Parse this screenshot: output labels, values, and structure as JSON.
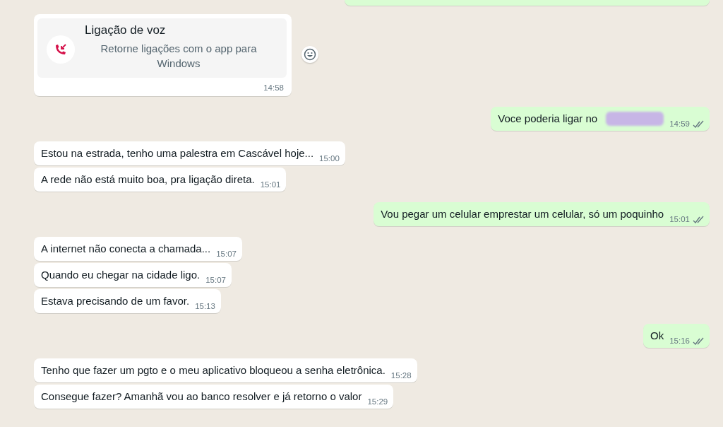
{
  "messages": [
    {
      "kind": "clipped_out"
    },
    {
      "kind": "call",
      "title": "Ligação de voz",
      "subtitle": "Retorne ligações com o app para Windows",
      "time": "14:58"
    },
    {
      "kind": "out",
      "text": "Voce poderia ligar no",
      "redacted": true,
      "time": "14:59",
      "read": false
    },
    {
      "kind": "in",
      "text": "Estou na estrada, tenho uma palestra em Cascável hoje...",
      "time": "15:00"
    },
    {
      "kind": "in",
      "text": "A rede não está muito boa, pra ligação direta.",
      "time": "15:01"
    },
    {
      "kind": "out",
      "text": "Vou pegar um celular emprestar um celular, só um poquinho",
      "redacted": false,
      "time": "15:01",
      "read": false
    },
    {
      "kind": "in",
      "text": "A internet não conecta a chamada...",
      "time": "15:07"
    },
    {
      "kind": "in",
      "text": "Quando eu chegar na cidade ligo.",
      "time": "15:07"
    },
    {
      "kind": "in",
      "text": "Estava precisando de um favor.",
      "time": "15:13"
    },
    {
      "kind": "out",
      "text": "Ok",
      "redacted": false,
      "time": "15:16",
      "read": false
    },
    {
      "kind": "in",
      "text": "Tenho que fazer um pgto e o meu aplicativo bloqueou a senha eletrônica.",
      "time": "15:28"
    },
    {
      "kind": "in",
      "text": "Consegue fazer? Amanhã vou ao banco resolver e já retorno o valor",
      "time": "15:29"
    }
  ]
}
